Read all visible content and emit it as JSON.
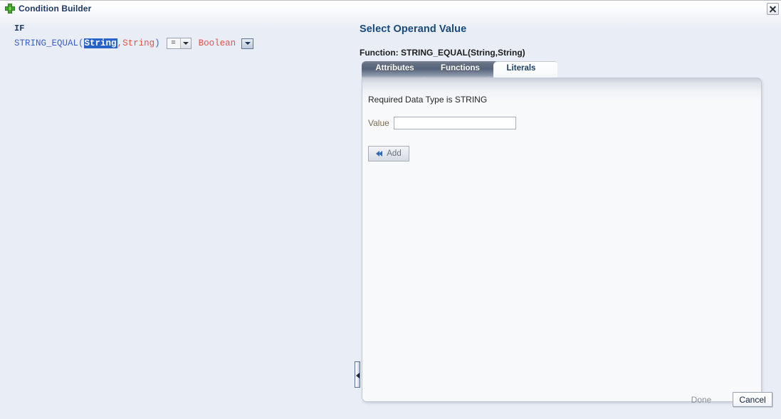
{
  "window": {
    "title": "Condition Builder",
    "icon": "green-plus-icon",
    "close_label": "×"
  },
  "left_pane": {
    "if_label": "IF",
    "expression": {
      "function_name": "STRING_EQUAL",
      "open_paren": "(",
      "arg1": "String",
      "comma": ",",
      "arg2": "String",
      "close_paren": ")",
      "operator_value": "=",
      "return_type": "Boolean"
    }
  },
  "right_pane": {
    "title": "Select Operand Value",
    "function_line": "Function: STRING_EQUAL(String,String)",
    "tabs": [
      {
        "label": "Attributes",
        "active": false
      },
      {
        "label": "Functions",
        "active": false
      },
      {
        "label": "Literals",
        "active": true
      }
    ],
    "literals": {
      "required_type_text": "Required Data Type is STRING",
      "value_label": "Value",
      "value_input": "",
      "value_placeholder": "",
      "add_label": "Add"
    },
    "footer": {
      "done_label": "Done",
      "cancel_label": "Cancel"
    }
  },
  "colors": {
    "background": "#e9edf6",
    "panel": "#f8f9fb",
    "title_text": "#1f3864",
    "heading": "#1a4a7a",
    "accent_blue": "#3a5fcd",
    "accent_red": "#e8504a",
    "selection": "#2a63c8",
    "value_label": "#7a6a4a",
    "icon_green": "#43a92d"
  }
}
